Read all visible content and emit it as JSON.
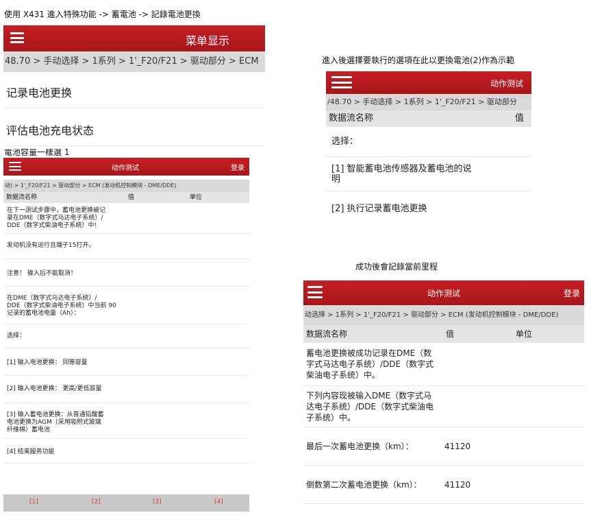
{
  "captions": {
    "top": "使用 X431 進入特殊功能  ->  蓄電池  ->  記錄電池更換",
    "capacity": "電池容量一樣選 1",
    "right": "進入後選擇要執行的選項在此以更換電池(2)作為示範",
    "success": "成功後會記錄當前里程"
  },
  "panel1": {
    "title": "菜单显示",
    "breadcrumb": "48.70 > 手动选择 > 1系列 > 1'_F20/F21 > 驱动部分 > ECM",
    "items": [
      "记录电池更换",
      "评估电池充电状态"
    ]
  },
  "panel2": {
    "title": "动作测试",
    "login": "登录",
    "breadcrumb": "动) > 1'_F20/F21 > 驱动部分 > ECM (发动机控制模块 - DME/DDE)",
    "columns": [
      "数据流名称",
      "值",
      "单位"
    ],
    "rows": [
      "在下一测试步骤中，蓄电池更换被记\n录在DME（数字式马达电子系统）/\nDDE（数字式柴油电子系统）中!",
      "发动机没有运行且端子15打开。",
      "注意！ 输入后不能取消！",
      "在DME（数字式马达电子系统）/\nDDE（数字式柴油电子系统）中当前  90\n记录的蓄电池电量（Ah）：",
      "选择：",
      "[1] 输入电池更换： 同等容量",
      "[2] 输入电池更换： 更高/更低容量",
      "[3] 输入蓄电池更换：从普通铅酸蓄\n电池更换为AGM（采用吸附式玻璃\n纤维棉）蓄电池",
      "[4] 结束服务功能"
    ],
    "footer_buttons": [
      "[1]",
      "[2]",
      "[3]",
      "[4]"
    ]
  },
  "panel3": {
    "title": "动作测试",
    "breadcrumb": "/48.70 > 手动选择 > 1系列 > 1'_F20/F21 > 驱动部分",
    "columns": [
      "数据流名称",
      "值"
    ],
    "rows": [
      "选择：",
      "[1] 智能蓄电池传感器及蓄电池的说\n明",
      "[2] 执行记录蓄电池更换"
    ]
  },
  "panel4": {
    "title": "动作测试",
    "login": "登录",
    "breadcrumb": "动选择 > 1系列 > 1'_F20/F21 > 驱动部分 > ECM (发动机控制模块 - DME/DDE)",
    "columns": [
      "数据流名称",
      "值",
      "单位"
    ],
    "rows": [
      {
        "label": "蓄电池更换被成功记录在DME（数\n字式马达电子系统）/DDE（数字式\n柴油电子系统）中。",
        "value": ""
      },
      {
        "label": "下列内容现被输入DME（数字式马\n达电子系统）/DDE（数字式柴油电\n子系统）中。",
        "value": ""
      },
      {
        "label": "最后一次蓄电池更换（km）：",
        "value": "41120"
      },
      {
        "label": "倒数第二次蓄电池更换（km）：",
        "value": "41120"
      }
    ]
  }
}
